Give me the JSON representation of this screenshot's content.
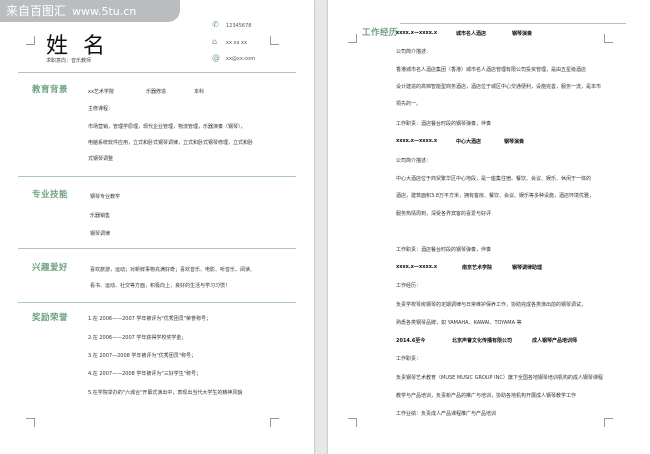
{
  "watermark": {
    "text": "来自百图汇",
    "site": "www.5tu.cn"
  },
  "profile": {
    "name": "姓 名",
    "intention": "求职意向：音乐教师",
    "phone": "12345678",
    "qq": "xx xx xx",
    "email": "xx@xx.com"
  },
  "left_sections": {
    "education": {
      "title": "教育背景",
      "school": "xx艺术学院",
      "major": "乐器修造",
      "degree": "本科",
      "courses_label": "主修课程：",
      "courses_lines": [
        "市场营销，管理学原理，现代企业管理，物流管理，乐器演奏（钢琴），",
        "电脑系统软件应用，立式和卧式钢琴调律，立式和卧式钢琴修理，立式和卧",
        "式钢琴调整"
      ]
    },
    "skills": {
      "title": "专业技能",
      "items": [
        "钢琴专业教学",
        "乐器销售",
        "钢琴调律"
      ]
    },
    "hobbies": {
      "title": "兴趣爱好",
      "lines": [
        "喜欢旅游，运动；对新鲜事物充满好奇；喜欢音乐、电影、听音乐、阅读、",
        "看书、运动、社交等方面，积极向上，良好的生活与学习习惯！"
      ]
    },
    "awards": {
      "title": "奖励荣誉",
      "items": [
        "1.在 2006——2007 学年被评为\"优秀团员\"荣誉称号；",
        "2.在 2006——2007 学年获得学校奖学金；",
        "3.在 2007—2008 学年被评为\"优秀团员\"称号；",
        "4.在 2007——2008 学年被评为\"三好学生\"称号；",
        "5.在学院举办的\"六城合\"开幕式演出中，表现出当代大学生的精神风貌"
      ]
    }
  },
  "work": {
    "title": "工作经历",
    "jobs": [
      {
        "dates": "xxxx.x—xxxx.x",
        "company": "城市名人酒店",
        "role": "钢琴演奏",
        "intro_label": "公司简介描述：",
        "intro_lines": [
          "香港城市名人酒店集团（香港）城市名人酒店管理有限公司投资管理，是由五星级酒店",
          "设计建造的高档智能型商务酒店，酒店位于城区中心交通便利，设施完善，服务一流，是本市",
          "领先的一。"
        ],
        "duty": "工作职责：酒店餐台时段的钢琴弹奏，伴奏"
      },
      {
        "dates": "xxxx.x—xxxx.x",
        "company": "中心大酒店",
        "role": "钢琴演奏",
        "intro_label": "公司简介描述：",
        "intro_lines": [
          "中心大酒店位于商贸繁华区中心地段，是一座集住宿、餐饮、会议、娱乐、休闲于一体的",
          "酒店，建筑面积3.8万平方米，拥有客房、餐饮、会议、娱乐等多种设施，酒店环境优雅，",
          "服务热情周到，深受各界宾客的喜爱与好评"
        ],
        "duty": "工作职责：酒店餐台时段的钢琴弹奏，伴奏"
      },
      {
        "dates": "xxxx.x—xxxx.x",
        "company": "南京艺术学院",
        "role": "钢琴调律助理",
        "intro_label": "工作经历：",
        "intro_lines": [
          "负责学校琴房钢琴的定期调律与日常维护保养工作，协助完成各类演出前的钢琴调试，",
          "熟悉各类钢琴品牌，如 YAMAHA、KAWAI、TOYAMA 等"
        ],
        "duty": ""
      },
      {
        "dates": "2014.6至今",
        "company": "北京声誉文化传播有限公司",
        "role": "成人钢琴产品培训师",
        "intro_label": "工作职责：",
        "intro_lines": [
          "负责钢琴艺术教育（MUSE MUSIC GROUP INC）旗下全国各地钢琴培训机构的成人钢琴课程",
          "教学与产品培训，负责新产品的推广与培训，协助各地机构开展成人钢琴教学工作"
        ],
        "duty": "工作业绩：负责成人产品课程推广与产品培训"
      }
    ]
  }
}
